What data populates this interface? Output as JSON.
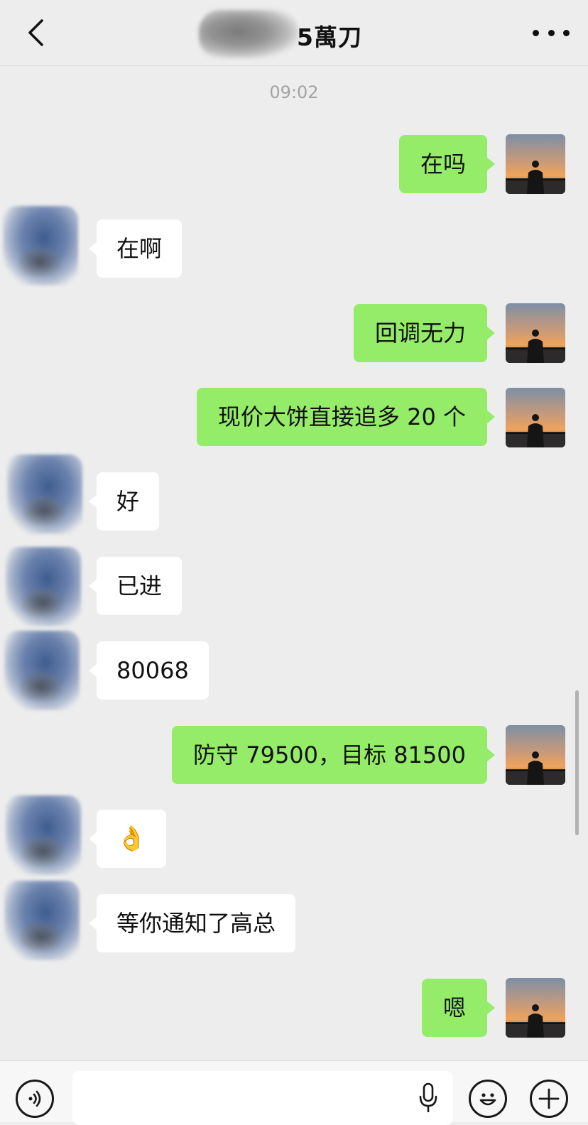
{
  "header": {
    "title": "5萬刀",
    "back_icon": "chevron-left-icon",
    "more_icon": "more-dots-icon"
  },
  "chat": {
    "timestamp": "09:02",
    "messages": [
      {
        "from": "me",
        "text": "在吗"
      },
      {
        "from": "them",
        "text": "在啊"
      },
      {
        "from": "me",
        "text": "回调无力"
      },
      {
        "from": "me",
        "text": "现价大饼直接追多 20 个"
      },
      {
        "from": "them",
        "text": "好"
      },
      {
        "from": "them",
        "text": "已进"
      },
      {
        "from": "them",
        "text": "80068"
      },
      {
        "from": "me",
        "text": "防守 79500，目标 81500"
      },
      {
        "from": "them",
        "text": "👌"
      },
      {
        "from": "them",
        "text": "等你通知了高总"
      },
      {
        "from": "me",
        "text": "嗯"
      }
    ]
  },
  "input_bar": {
    "voice_icon": "voice-icon",
    "mic_icon": "microphone-icon",
    "emoji_icon": "emoji-icon",
    "plus_icon": "plus-icon"
  },
  "colors": {
    "background": "#ededed",
    "my_bubble": "#95ec69",
    "their_bubble": "#ffffff"
  }
}
